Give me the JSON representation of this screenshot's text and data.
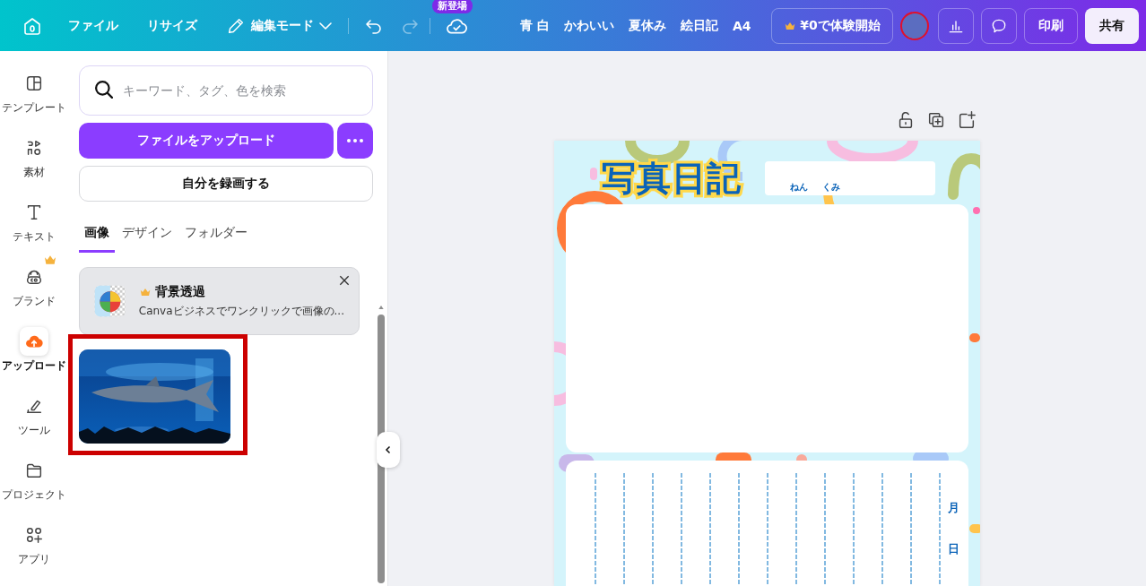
{
  "top_bar": {
    "menu": [
      "ファイル",
      "リサイズ"
    ],
    "mode": "編集モード",
    "new_badge": "新登場",
    "tags": [
      "青 白",
      "かわいい",
      "夏休み",
      "絵日記",
      "A4"
    ],
    "trial_button": "¥0で体験開始",
    "print_button": "印刷",
    "share_button": "共有"
  },
  "sidebar": {
    "items": [
      {
        "label": "テンプレート",
        "selected": false
      },
      {
        "label": "素材",
        "selected": false
      },
      {
        "label": "テキスト",
        "selected": false
      },
      {
        "label": "ブランド",
        "selected": false
      },
      {
        "label": "アップロード",
        "selected": true
      },
      {
        "label": "ツール",
        "selected": false
      },
      {
        "label": "プロジェクト",
        "selected": false
      },
      {
        "label": "アプリ",
        "selected": false
      }
    ]
  },
  "panel": {
    "search": {
      "placeholder": "キーワード、タグ、色を検索"
    },
    "upload_button": "ファイルをアップロード",
    "record_button": "自分を録画する",
    "tabs": [
      {
        "label": "画像",
        "selected": true
      },
      {
        "label": "デザイン",
        "selected": false
      },
      {
        "label": "フォルダー",
        "selected": false
      }
    ],
    "promo": {
      "title": "背景透過",
      "text": "Canvaビジネスでワンクリックで画像の..."
    },
    "uploads": [
      {
        "kind": "picture",
        "highlighted": true
      }
    ]
  },
  "document": {
    "title": "写真日記",
    "name_labels": [
      "ねん",
      "くみ"
    ],
    "date_labels": [
      "月",
      "日"
    ]
  }
}
